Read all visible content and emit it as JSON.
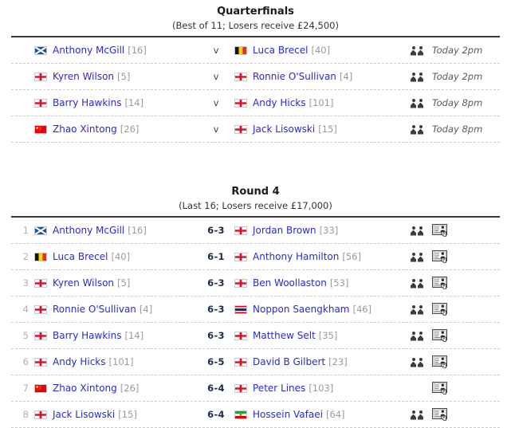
{
  "colors": {
    "link": "#2a2ad0",
    "rank": "#9a9a9a",
    "rule": "#3a3a3a",
    "separator": "#cccccc",
    "score": "#1a2b4a",
    "rownum": "#b0b0b0",
    "time": "#5a5a5a"
  },
  "sections": [
    {
      "id": "quarterfinals",
      "title": "Quarterfinals",
      "subtitle": "(Best of 11; Losers receive £24,500)",
      "layout": "fixture",
      "matches": [
        {
          "number": "",
          "home": {
            "name": "Anthony McGill",
            "rank": "[16]",
            "flag": "scotland"
          },
          "middle": "v",
          "away": {
            "name": "Luca Brecel",
            "rank": "[40]",
            "flag": "belgium"
          },
          "icons": {
            "people": true,
            "card": false
          },
          "time": "Today 2pm"
        },
        {
          "number": "",
          "home": {
            "name": "Kyren Wilson",
            "rank": "[5]",
            "flag": "england"
          },
          "middle": "v",
          "away": {
            "name": "Ronnie O'Sullivan",
            "rank": "[4]",
            "flag": "england"
          },
          "icons": {
            "people": true,
            "card": false
          },
          "time": "Today 2pm"
        },
        {
          "number": "",
          "home": {
            "name": "Barry Hawkins",
            "rank": "[14]",
            "flag": "england"
          },
          "middle": "v",
          "away": {
            "name": "Andy Hicks",
            "rank": "[101]",
            "flag": "england"
          },
          "icons": {
            "people": true,
            "card": false
          },
          "time": "Today 8pm"
        },
        {
          "number": "",
          "home": {
            "name": "Zhao Xintong",
            "rank": "[26]",
            "flag": "china"
          },
          "middle": "v",
          "away": {
            "name": "Jack Lisowski",
            "rank": "[15]",
            "flag": "england"
          },
          "icons": {
            "people": true,
            "card": false
          },
          "time": "Today 8pm"
        }
      ]
    },
    {
      "id": "round-4",
      "title": "Round 4",
      "subtitle": "(Last 16; Losers receive £17,000)",
      "layout": "result",
      "matches": [
        {
          "number": "1",
          "home": {
            "name": "Anthony McGill",
            "rank": "[16]",
            "flag": "scotland"
          },
          "middle": "6-3",
          "away": {
            "name": "Jordan Brown",
            "rank": "[33]",
            "flag": "england"
          },
          "icons": {
            "people": true,
            "card": true
          },
          "time": ""
        },
        {
          "number": "2",
          "home": {
            "name": "Luca Brecel",
            "rank": "[40]",
            "flag": "belgium"
          },
          "middle": "6-1",
          "away": {
            "name": "Anthony Hamilton",
            "rank": "[56]",
            "flag": "england"
          },
          "icons": {
            "people": true,
            "card": true
          },
          "time": ""
        },
        {
          "number": "3",
          "home": {
            "name": "Kyren Wilson",
            "rank": "[5]",
            "flag": "england"
          },
          "middle": "6-3",
          "away": {
            "name": "Ben Woollaston",
            "rank": "[53]",
            "flag": "england"
          },
          "icons": {
            "people": true,
            "card": true
          },
          "time": ""
        },
        {
          "number": "4",
          "home": {
            "name": "Ronnie O'Sullivan",
            "rank": "[4]",
            "flag": "england"
          },
          "middle": "6-3",
          "away": {
            "name": "Noppon Saengkham",
            "rank": "[46]",
            "flag": "thailand"
          },
          "icons": {
            "people": true,
            "card": true
          },
          "time": ""
        },
        {
          "number": "5",
          "home": {
            "name": "Barry Hawkins",
            "rank": "[14]",
            "flag": "england"
          },
          "middle": "6-3",
          "away": {
            "name": "Matthew Selt",
            "rank": "[35]",
            "flag": "england"
          },
          "icons": {
            "people": true,
            "card": true
          },
          "time": ""
        },
        {
          "number": "6",
          "home": {
            "name": "Andy Hicks",
            "rank": "[101]",
            "flag": "england"
          },
          "middle": "6-5",
          "away": {
            "name": "David B Gilbert",
            "rank": "[23]",
            "flag": "england"
          },
          "icons": {
            "people": true,
            "card": true
          },
          "time": ""
        },
        {
          "number": "7",
          "home": {
            "name": "Zhao Xintong",
            "rank": "[26]",
            "flag": "china"
          },
          "middle": "6-4",
          "away": {
            "name": "Peter Lines",
            "rank": "[103]",
            "flag": "england"
          },
          "icons": {
            "people": false,
            "card": true
          },
          "time": ""
        },
        {
          "number": "8",
          "home": {
            "name": "Jack Lisowski",
            "rank": "[15]",
            "flag": "england"
          },
          "middle": "6-4",
          "away": {
            "name": "Hossein Vafaei",
            "rank": "[64]",
            "flag": "iran"
          },
          "icons": {
            "people": true,
            "card": true
          },
          "time": ""
        }
      ]
    }
  ],
  "icon_names": {
    "people": "head-to-head-icon",
    "card": "match-scorecard-icon"
  }
}
